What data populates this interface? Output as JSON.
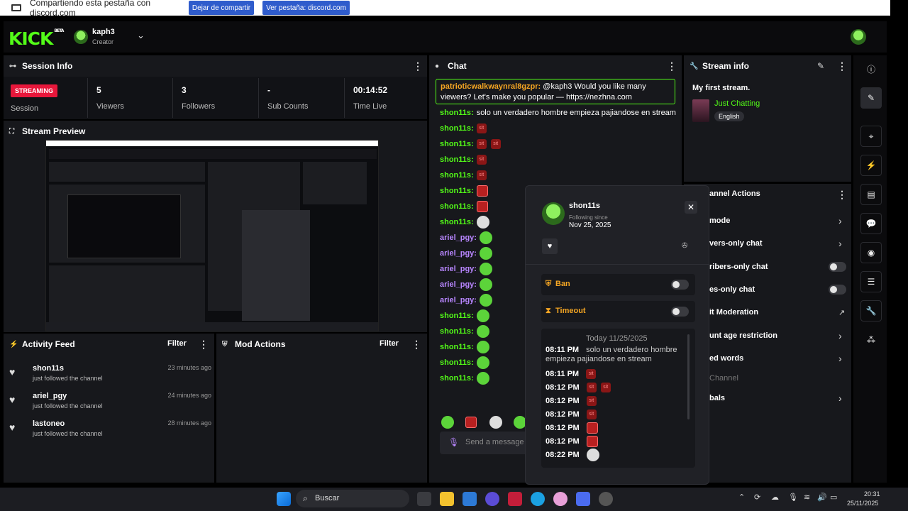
{
  "share_bar": {
    "text": "Compartiendo esta pestaña con discord.com",
    "stop_label": "Dejar de compartir",
    "view_label": "Ver pestaña: discord.com"
  },
  "nav": {
    "logo": "KICK",
    "logo_badge": "BETA",
    "username": "kaph3",
    "role": "Creator"
  },
  "session": {
    "title": "Session Info",
    "badge": "STREAMING",
    "session_label": "Session",
    "stats": [
      {
        "value": "5",
        "label": "Viewers"
      },
      {
        "value": "3",
        "label": "Followers"
      },
      {
        "value": "-",
        "label": "Sub Counts"
      },
      {
        "value": "00:14:52",
        "label": "Time Live"
      }
    ]
  },
  "preview": {
    "title": "Stream Preview"
  },
  "activity": {
    "title": "Activity Feed",
    "filter": "Filter",
    "items": [
      {
        "name": "shon11s",
        "desc": "just followed the channel",
        "time": "23 minutes ago"
      },
      {
        "name": "ariel_pgy",
        "desc": "just followed the channel",
        "time": "24 minutes ago"
      },
      {
        "name": "lastoneo",
        "desc": "just followed the channel",
        "time": "28 minutes ago"
      }
    ]
  },
  "mod_actions": {
    "title": "Mod Actions",
    "filter": "Filter"
  },
  "chat": {
    "title": "Chat",
    "pinned_user": "patrioticwalkwaynral8gzpr:",
    "pinned_text": "@kaph3 Would you like many viewers? Let's make you popular — https://nezhna.com",
    "first_user": "shon11s:",
    "first_text": "solo un verdadero hombre empieza pajiandose en stream",
    "users": [
      "shon11s:",
      "shon11s:",
      "shon11s:",
      "shon11s:",
      "shon11s:",
      "shon11s:",
      "shon11s:",
      "ariel_pgy:",
      "ariel_pgy:",
      "ariel_pgy:",
      "ariel_pgy:",
      "ariel_pgy:",
      "shon11s:",
      "shon11s:",
      "shon11s:",
      "shon11s:",
      "shon11s:"
    ],
    "send_placeholder": "Send a message"
  },
  "stream_info": {
    "title": "Stream info",
    "stream_title": "My first stream.",
    "category": "Just Chatting",
    "language": "English"
  },
  "channel_actions": {
    "title": "annel Actions",
    "items": [
      {
        "label": "mode"
      },
      {
        "label": "vers-only chat"
      },
      {
        "label": "ribers-only chat"
      },
      {
        "label": "es-only chat"
      },
      {
        "label": "it Moderation"
      },
      {
        "label": "unt age restriction"
      },
      {
        "label": "ed words"
      },
      {
        "label": "Channel"
      },
      {
        "label": "bals"
      }
    ]
  },
  "user_card": {
    "username": "shon11s",
    "following_label": "Following since",
    "following_date": "Nov 25, 2025",
    "ban_label": "Ban",
    "timeout_label": "Timeout",
    "date_header": "Today 11/25/2025",
    "log": [
      {
        "time": "08:11 PM",
        "text": "solo un verdadero hombre empieza pajiandose en stream"
      },
      {
        "time": "08:11 PM",
        "text": ""
      },
      {
        "time": "08:12 PM",
        "text": ""
      },
      {
        "time": "08:12 PM",
        "text": ""
      },
      {
        "time": "08:12 PM",
        "text": ""
      },
      {
        "time": "08:12 PM",
        "text": ""
      },
      {
        "time": "08:12 PM",
        "text": ""
      },
      {
        "time": "08:22 PM",
        "text": ""
      }
    ]
  },
  "taskbar": {
    "search": "Buscar",
    "time": "20:31",
    "date": "25/11/2025"
  },
  "colors": {
    "brand": "#53fc18",
    "badge": "#e8173b",
    "panel": "#17181c"
  }
}
